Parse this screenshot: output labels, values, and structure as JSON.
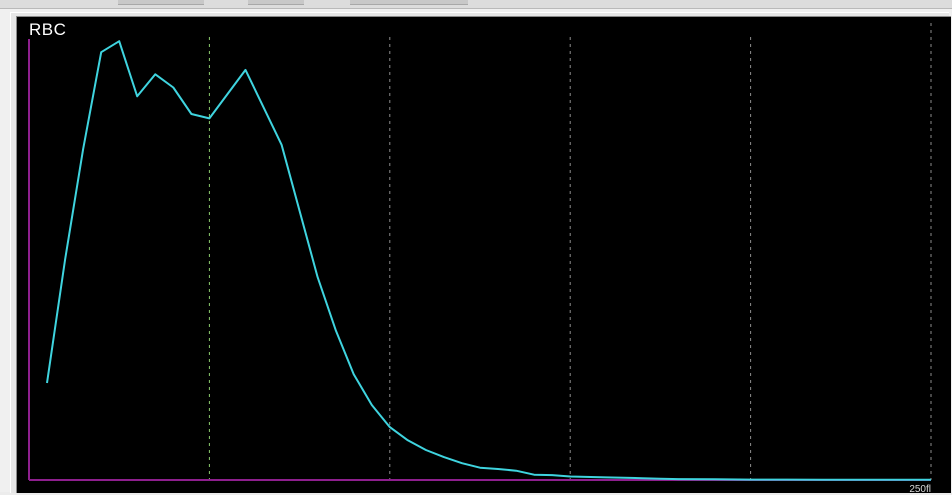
{
  "chart_data": {
    "type": "line",
    "title": "RBC",
    "xlabel": "",
    "ylabel": "",
    "xlim": [
      0,
      250
    ],
    "ylim": [
      0,
      100
    ],
    "x_tick_labels": [
      {
        "x": 250,
        "label": "250fl"
      }
    ],
    "grid": {
      "vertical_dashed_at": [
        50,
        100,
        150,
        200,
        250
      ]
    },
    "series": [
      {
        "color": "#3fd4df",
        "x": [
          5,
          10,
          15,
          20,
          25,
          30,
          35,
          40,
          45,
          50,
          60,
          70,
          80,
          85,
          90,
          95,
          100,
          105,
          110,
          115,
          120,
          125,
          130,
          135,
          140,
          145,
          150,
          160,
          170,
          175,
          180,
          190,
          200,
          210,
          220,
          230,
          240,
          250
        ],
        "y": [
          22,
          50,
          75,
          97,
          99.5,
          87,
          92,
          89,
          83,
          82,
          93,
          76,
          46,
          34,
          24,
          17,
          12,
          9,
          6.8,
          5.2,
          3.8,
          2.8,
          2.5,
          2.1,
          1.2,
          1.1,
          0.8,
          0.6,
          0.4,
          0.3,
          0.2,
          0.15,
          0.1,
          0.1,
          0.05,
          0.05,
          0.05,
          0.05
        ]
      }
    ]
  }
}
